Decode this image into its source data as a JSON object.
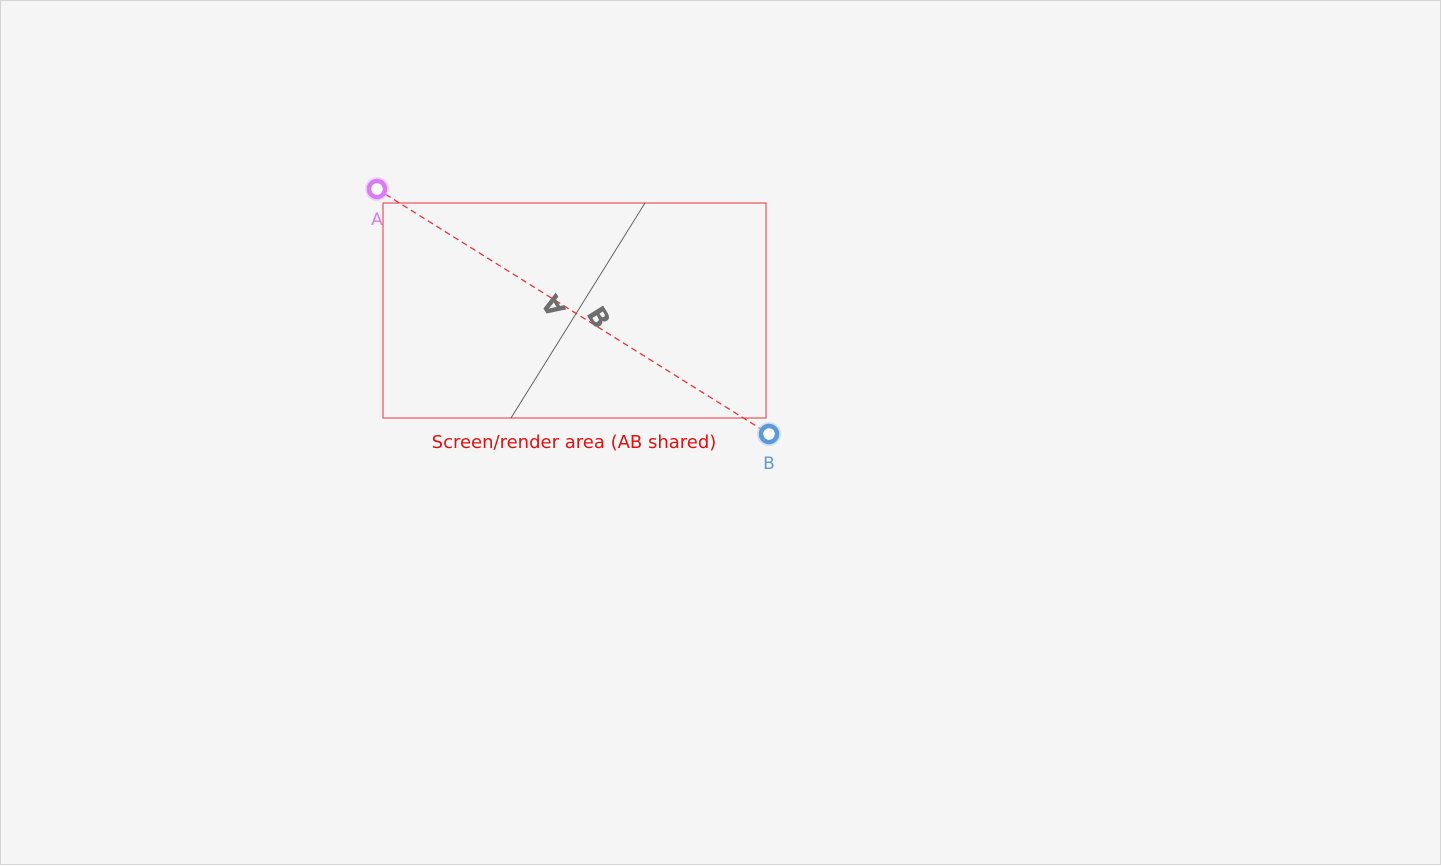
{
  "diagram": {
    "area_caption": "Screen/render area (AB shared)",
    "handle_a_label": "A",
    "handle_b_label": "B",
    "split_side_a": "A",
    "split_side_b": "B"
  },
  "colors": {
    "background": "#f5f5f6",
    "area_border": "#e8333a",
    "caption": "#e01010",
    "handle_a": "#d77cf2",
    "handle_b": "#5b9ad6",
    "split_line": "#555555",
    "side_text": "#6e6e6e"
  }
}
